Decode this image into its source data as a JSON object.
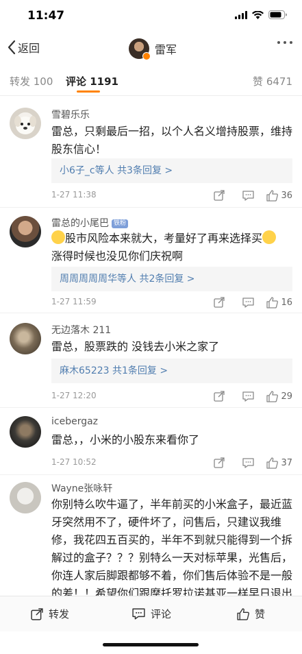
{
  "status": {
    "time": "11:47"
  },
  "nav": {
    "back_label": "返回",
    "title": "雷军"
  },
  "tabs": {
    "repost": "转发 100",
    "comment": "评论 1191",
    "like": "赞 6471"
  },
  "comments": [
    {
      "name": "雪碧乐乐",
      "text": "雷总，只剩最后一招，以个人名义增持股票，维持股东信心！",
      "replies_users": "小6子_c等人",
      "replies_count": "共3条回复 >",
      "time": "1-27 11:38",
      "likes": "36"
    },
    {
      "name": "雷总的小尾巴",
      "badge": "铁粉",
      "text": "股市风险本来就大，考量好了再来选择买",
      "text2": "涨得时候也没见你们庆祝啊",
      "replies_users": "周周周周周华等人",
      "replies_count": "共2条回复 >",
      "time": "1-27 11:59",
      "likes": "16"
    },
    {
      "name": "无边落木 211",
      "text": "雷总，股票跌的 没钱去小米之家了",
      "replies_users": "麻木65223",
      "replies_count": "共1条回复 >",
      "time": "1-27 12:20",
      "likes": "29"
    },
    {
      "name": "icebergaz",
      "text": "雷总，，小米的小股东来看你了",
      "time": "1-27 10:52",
      "likes": "37"
    },
    {
      "name": "Wayne张咏轩",
      "text": "你别特么吹牛逼了，半年前买的小米盒子，最近蓝牙突然用不了，硬件坏了，问售后，只建议我维修，我花四五百买的，半年不到就只能得到一个拆解过的盒子？？？别特么一天对标苹果，光售后，你连人家后脚跟都够不着，你们售后体验不是一般的差！！希望你们跟摩托罗拉诺基亚一样早日退出大众视野"
    }
  ],
  "bottom": {
    "repost": "转发",
    "comment": "评论",
    "like": "赞"
  },
  "colors": {
    "accent": "#ff8200",
    "link": "#507daf"
  }
}
